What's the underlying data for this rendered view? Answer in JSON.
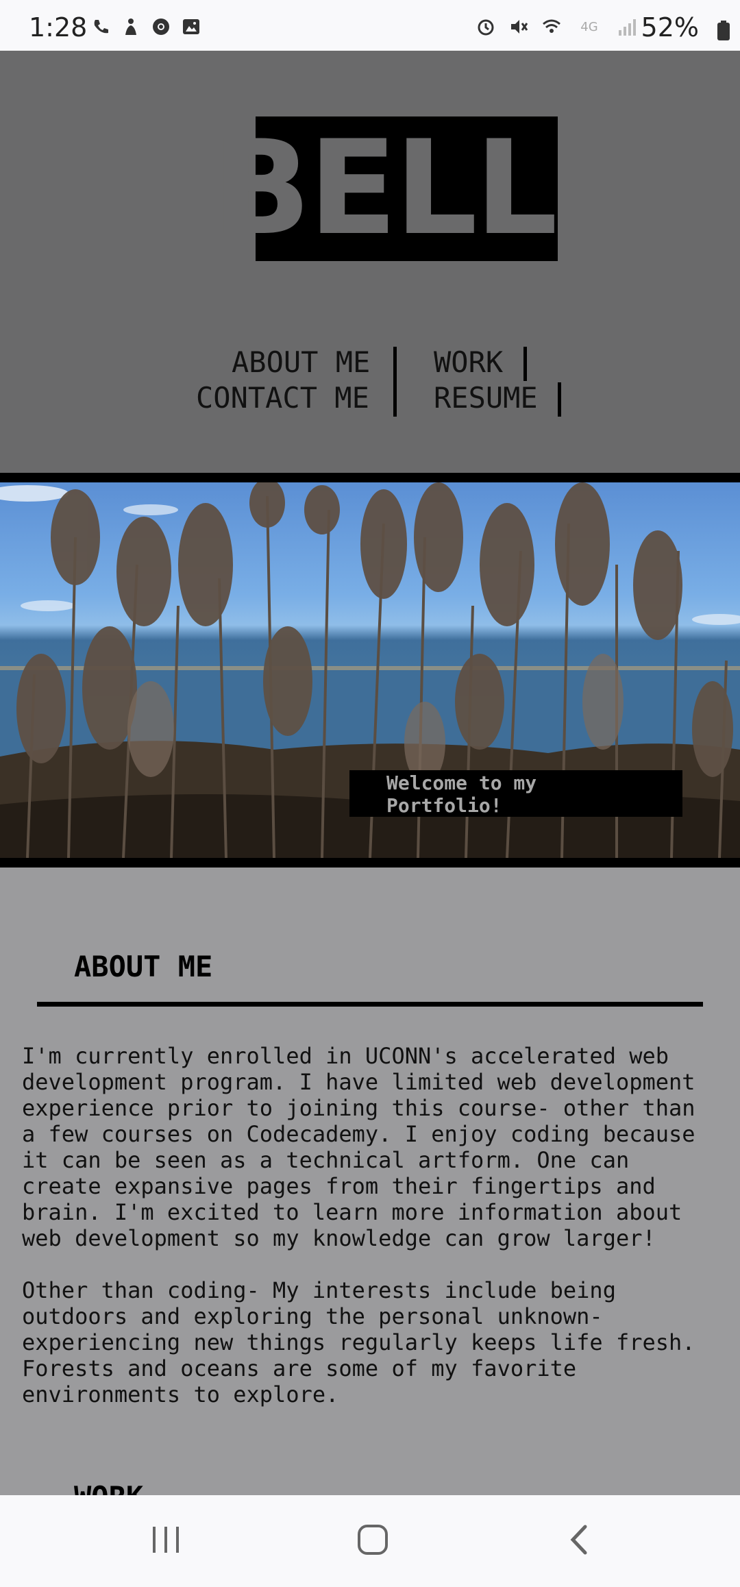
{
  "status_bar": {
    "time": "1:28",
    "battery_percent": "52%",
    "network": "4G"
  },
  "header": {
    "logo_text": "BELL",
    "nav": {
      "about": "ABOUT ME",
      "work": "WORK",
      "contact": "CONTACT ME",
      "resume": "RESUME"
    }
  },
  "hero": {
    "caption_line1": "Welcome to my",
    "caption_line2": "Portfolio!"
  },
  "about": {
    "title": "ABOUT ME",
    "paragraph1": "I'm currently enrolled in UCONN's accelerated web development program. I have limited web development experience prior to joining this course- other than a few courses on Codecademy. I enjoy coding because it can be seen as a technical artform. One can create expansive pages from their fingertips and brain. I'm excited to learn more information about web development so my knowledge can grow larger!",
    "paragraph2": "Other than coding- My interests include being outdoors and exploring the personal unknown- experiencing new things regularly keeps life fresh. Forests and oceans are some of my favorite environments to explore."
  },
  "work": {
    "title": "WORK"
  },
  "colors": {
    "header_bg": "#6a6a6b",
    "body_bg": "#9b9b9d",
    "logo_bg": "#000000"
  },
  "icons": {
    "android_nav": [
      "recent-apps-icon",
      "home-icon",
      "back-icon"
    ]
  }
}
